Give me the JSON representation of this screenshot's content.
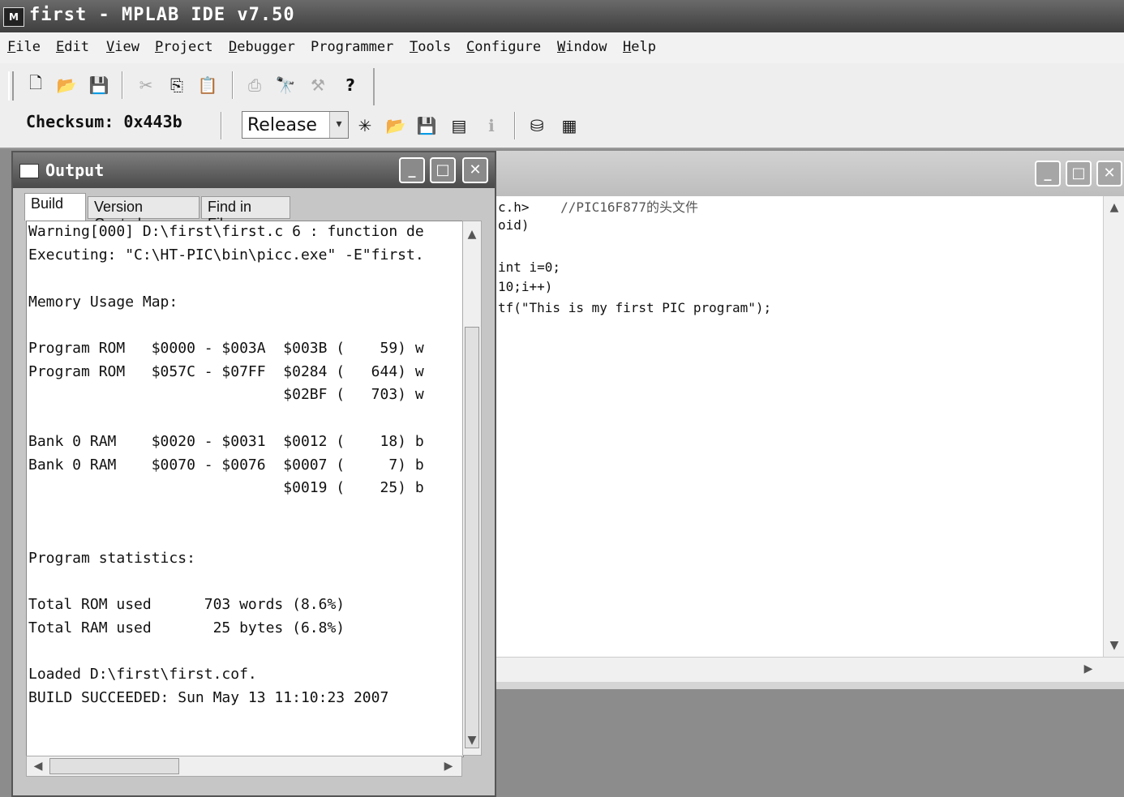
{
  "window": {
    "title": "first - MPLAB IDE v7.50",
    "app_icon_text": "M"
  },
  "menu": [
    {
      "label": "File",
      "key": "F",
      "rest": "ile"
    },
    {
      "label": "Edit",
      "key": "E",
      "rest": "dit"
    },
    {
      "label": "View",
      "key": "V",
      "rest": "iew"
    },
    {
      "label": "Project",
      "key": "P",
      "rest": "roject"
    },
    {
      "label": "Debugger",
      "key": "D",
      "rest": "ebugger"
    },
    {
      "label": "Programmer",
      "key": "",
      "rest": "Programmer"
    },
    {
      "label": "Tools",
      "key": "T",
      "rest": "ools"
    },
    {
      "label": "Configure",
      "key": "C",
      "rest": "onfigure"
    },
    {
      "label": "Window",
      "key": "W",
      "rest": "indow"
    },
    {
      "label": "Help",
      "key": "H",
      "rest": "elp"
    }
  ],
  "toolbar": {
    "checksum_label": "Checksum:",
    "checksum_value": "0x443b",
    "build_config": "Release",
    "icons": {
      "new": "new-file-icon",
      "open": "open-folder-icon",
      "save": "save-icon",
      "cut": "cut-icon",
      "copy": "copy-icon",
      "paste": "paste-icon",
      "print": "print-icon",
      "find": "binoculars-icon",
      "find_files": "find-in-files-icon",
      "help": "help-icon"
    },
    "glyphs": {
      "new": "🗋",
      "open": "📂",
      "save": "💾",
      "cut": "✂",
      "copy": "⎘",
      "paste": "📋",
      "print": "⎙",
      "find": "🔭",
      "find_files": "⚒",
      "help": "?",
      "new_project": "✳",
      "open_project": "📂",
      "save_project": "💾",
      "build_all": "▤",
      "info": "ℹ",
      "make": "⛁",
      "build": "▦"
    }
  },
  "editor": {
    "lines": [
      {
        "code": "c.h>",
        "comment": "    //PIC16F877的头文件"
      },
      {
        "code": "oid)",
        "comment": ""
      },
      {
        "code": "",
        "comment": ""
      },
      {
        "code": "int i=0;",
        "comment": ""
      },
      {
        "code": "10;i++)",
        "comment": ""
      },
      {
        "code": "tf(\"This is my first PIC program\");",
        "comment": ""
      }
    ]
  },
  "output": {
    "title": "Output",
    "tabs": [
      "Build",
      "Version Control",
      "Find in Files"
    ],
    "active_tab": "Build",
    "lines": [
      "Warning[000] D:\\first\\first.c 6 : function de",
      "Executing: \"C:\\HT-PIC\\bin\\picc.exe\" -E\"first.",
      "",
      "Memory Usage Map:",
      "",
      "Program ROM   $0000 - $003A  $003B (    59) w",
      "Program ROM   $057C - $07FF  $0284 (   644) w",
      "                             $02BF (   703) w",
      "",
      "Bank 0 RAM    $0020 - $0031  $0012 (    18) b",
      "Bank 0 RAM    $0070 - $0076  $0007 (     7) b",
      "                             $0019 (    25) b",
      "",
      "",
      "Program statistics:",
      "",
      "Total ROM used      703 words (8.6%)",
      "Total RAM used       25 bytes (6.8%)",
      "",
      "Loaded D:\\first\\first.cof.",
      "BUILD SUCCEEDED: Sun May 13 11:10:23 2007"
    ]
  }
}
